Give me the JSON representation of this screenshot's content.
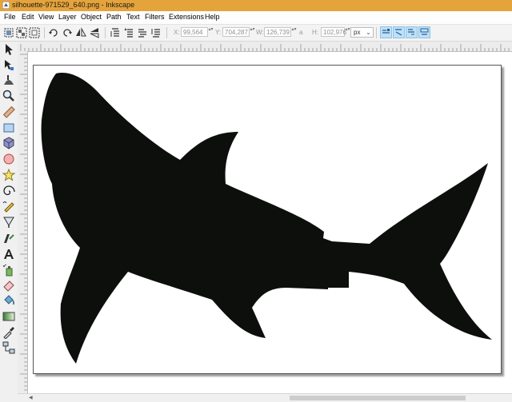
{
  "window": {
    "title": "silhouette-971529_640.png - Inkscape"
  },
  "menu": [
    "File",
    "Edit",
    "View",
    "Layer",
    "Object",
    "Path",
    "Text",
    "Filters",
    "Extensions",
    "Help"
  ],
  "toolbar": {
    "x_label": "X:",
    "x_value": "99,564",
    "y_label": "Y:",
    "y_value": "704,287",
    "w_label": "W:",
    "w_value": "126,739",
    "h_label": "H:",
    "h_value": "102,976",
    "unit": "px",
    "spin_glyph": "▴▾",
    "lock_glyph": "a"
  },
  "colors": {
    "titlebar": "#e5a33c",
    "silhouette": "#0c0f0c",
    "snap_active": "#bfe0f7"
  },
  "icons": {
    "toolbox": [
      "selector-icon",
      "node-icon",
      "tweak-icon",
      "zoom-icon",
      "measure-icon",
      "rectangle-icon",
      "box-3d-icon",
      "ellipse-icon",
      "star-icon",
      "spiral-icon",
      "pencil-icon",
      "pen-icon",
      "calligraphy-icon",
      "text-icon",
      "spray-icon",
      "eraser-icon",
      "paint-bucket-icon",
      "gradient-icon",
      "dropper-icon",
      "connector-icon"
    ]
  }
}
